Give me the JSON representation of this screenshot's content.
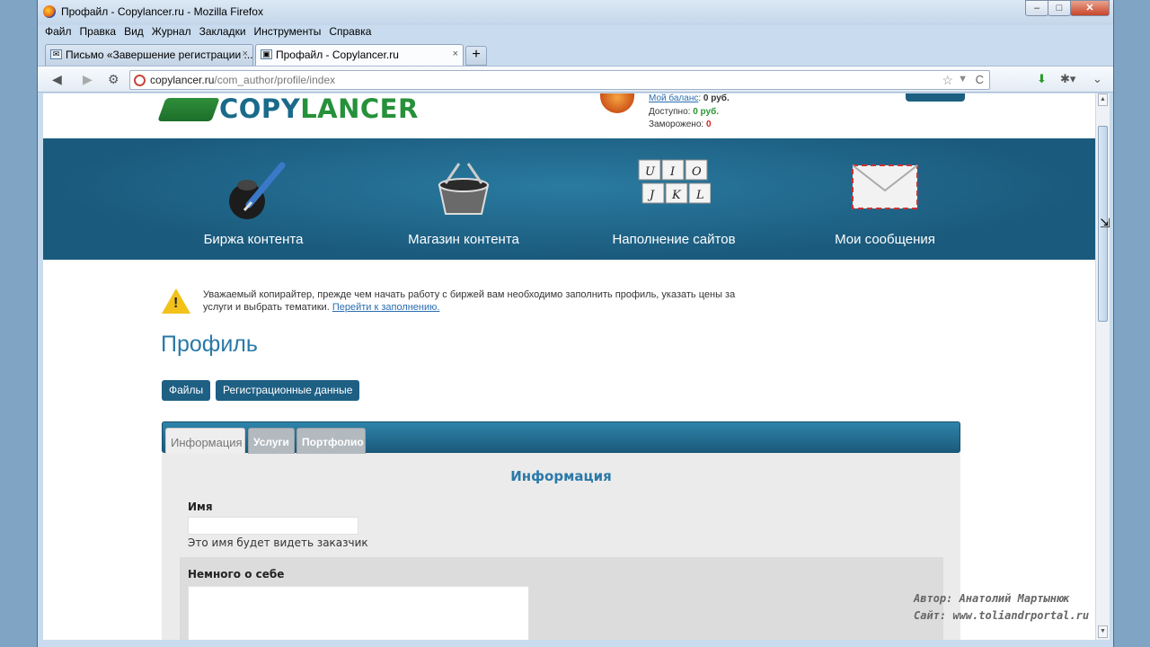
{
  "window": {
    "title": "Профайл - Copylancer.ru - Mozilla Firefox",
    "minimize": "–",
    "maximize": "□",
    "close": "✕"
  },
  "menu": [
    "Файл",
    "Правка",
    "Вид",
    "Журнал",
    "Закладки",
    "Инструменты",
    "Справка"
  ],
  "tabs": [
    {
      "label": "Письмо «Завершение регистрации ...",
      "close": "×"
    },
    {
      "label": "Профайл - Copylancer.ru",
      "close": "×"
    }
  ],
  "newtab": "+",
  "nav": {
    "back": "◀",
    "forward": "▶",
    "url_host": "copylancer.ru",
    "url_path": "/com_author/profile/index",
    "star": "☆",
    "dropdown": "▼",
    "reload": "C",
    "download": "⬇",
    "addon": "✱▾",
    "menu": "⌄"
  },
  "header": {
    "logo_part1": "COPY",
    "logo_part2": "LANCER",
    "balance_label": "Мой баланс",
    "balance_value": "0 руб.",
    "available_label": "Доступно:",
    "available_value": "0 руб.",
    "frozen_label": "Заморожено:",
    "frozen_value": "0",
    "colon": ":"
  },
  "banner": [
    {
      "label": "Биржа контента",
      "icon": "ink-pen-icon"
    },
    {
      "label": "Магазин контента",
      "icon": "shopping-basket-icon"
    },
    {
      "label": "Наполнение сайтов",
      "icon": "keyboard-keys-icon"
    },
    {
      "label": "Мои сообщения",
      "icon": "envelope-icon"
    }
  ],
  "keys": [
    "U",
    "I",
    "O",
    "J",
    "K",
    "L"
  ],
  "notice": {
    "text": "Уважаемый копирайтер, прежде чем начать работу с биржей вам необходимо заполнить профиль, указать цены за услуги и выбрать тематики.",
    "link": "Перейти к заполнению.",
    "mark": "!"
  },
  "page_title": "Профиль",
  "buttons": {
    "files": "Файлы",
    "registration": "Регистрационные данные"
  },
  "profile_tabs": [
    "Информация",
    "Услуги",
    "Портфолио"
  ],
  "section_title": "Информация",
  "form": {
    "name_label": "Имя",
    "name_value": "",
    "name_hint": "Это имя будет видеть заказчик",
    "about_label": "Немного о себе",
    "about_value": ""
  },
  "watermark": {
    "line1": "Автор: Анатолий Мартынюк",
    "line2": "Сайт: www.toliandrportal.ru"
  },
  "colors": {
    "accent": "#1e5f84",
    "title_blue": "#2a79a8",
    "logo_green": "#26913a",
    "warning": "#f2c21a"
  }
}
